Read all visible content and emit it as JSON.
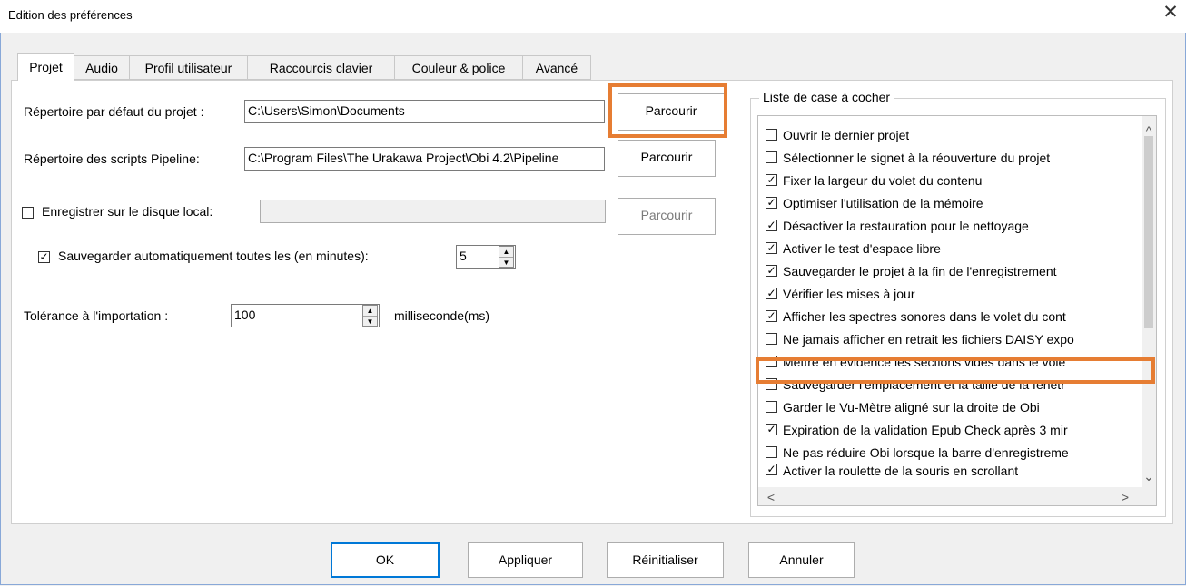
{
  "window": {
    "title": "Edition des préférences",
    "close_symbol": "✕"
  },
  "tabs": [
    {
      "label": "Projet",
      "active": true
    },
    {
      "label": "Audio",
      "active": false
    },
    {
      "label": "Profil utilisateur",
      "active": false
    },
    {
      "label": "Raccourcis clavier",
      "active": false
    },
    {
      "label": "Couleur & police",
      "active": false
    },
    {
      "label": "Avancé",
      "active": false
    }
  ],
  "project": {
    "default_directory_label": "Répertoire par défaut du projet :",
    "default_directory_value": "C:\\Users\\Simon\\Documents",
    "pipeline_directory_label": "Répertoire des scripts Pipeline:",
    "pipeline_directory_value": "C:\\Program Files\\The Urakawa Project\\Obi 4.2\\Pipeline",
    "local_disk_label": "Enregistrer sur le disque local:",
    "local_disk_value": "",
    "browse_label": "Parcourir",
    "autosave_label": "Sauvegarder automatiquement toutes les (en minutes):",
    "autosave_value": "5",
    "import_tolerance_label": "Tolérance à l'importation :",
    "import_tolerance_value": "100",
    "import_tolerance_unit": "milliseconde(ms)"
  },
  "checkbox_list": {
    "title": "Liste de case à cocher",
    "items": [
      {
        "label": "Ouvrir le dernier projet",
        "checked": false
      },
      {
        "label": "Sélectionner le signet à la réouverture du projet",
        "checked": false
      },
      {
        "label": "Fixer la largeur du volet du contenu",
        "checked": true
      },
      {
        "label": "Optimiser l'utilisation de la mémoire",
        "checked": true
      },
      {
        "label": "Désactiver la restauration pour le nettoyage",
        "checked": true
      },
      {
        "label": "Activer le test d'espace libre",
        "checked": true
      },
      {
        "label": "Sauvegarder le projet à la fin de l'enregistrement",
        "checked": true
      },
      {
        "label": "Vérifier les mises à jour",
        "checked": true
      },
      {
        "label": "Afficher les spectres sonores dans le volet du cont",
        "checked": true
      },
      {
        "label": "Ne jamais afficher en retrait les fichiers DAISY expo",
        "checked": false
      },
      {
        "label": "Mettre en évidence les sections vides dans le vole",
        "checked": false
      },
      {
        "label": "Sauvegarder l'emplacement et la taille de la fenêtr",
        "checked": false
      },
      {
        "label": "Garder le Vu-Mètre aligné sur la droite de Obi",
        "checked": false
      },
      {
        "label": "Expiration de la validation Epub Check après 3 mir",
        "checked": true
      },
      {
        "label": "Ne pas réduire Obi lorsque la barre d'enregistreme",
        "checked": false
      },
      {
        "label": "Activer la roulette de la souris en scrollant",
        "checked": true
      }
    ]
  },
  "buttons": {
    "ok": "OK",
    "apply": "Appliquer",
    "reset": "Réinitialiser",
    "cancel": "Annuler"
  },
  "colors": {
    "highlight": "#e67d33",
    "focus": "#0078d7"
  }
}
